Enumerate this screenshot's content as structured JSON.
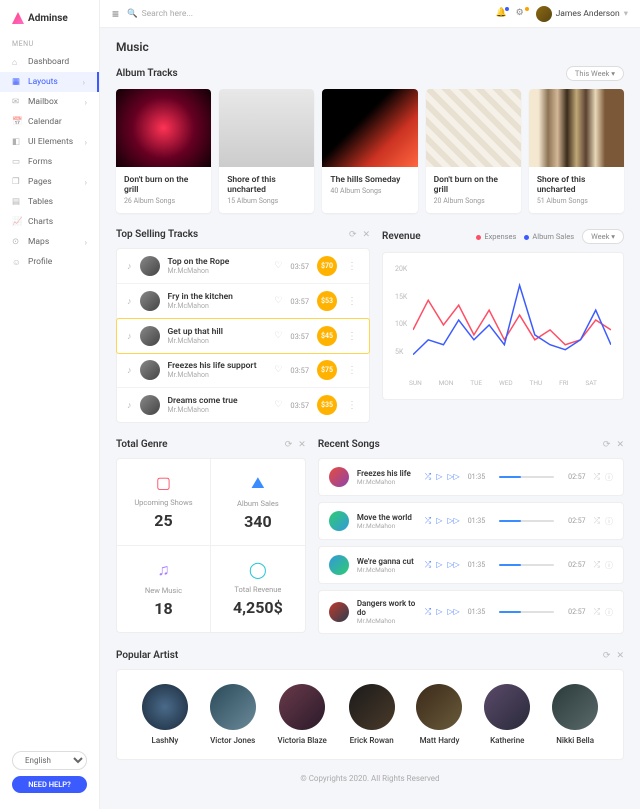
{
  "brand": "Adminse",
  "menuLabel": "MENU",
  "nav": [
    {
      "label": "Dashboard",
      "exp": false
    },
    {
      "label": "Layouts",
      "exp": true,
      "active": true
    },
    {
      "label": "Mailbox",
      "exp": true
    },
    {
      "label": "Calendar",
      "exp": false
    },
    {
      "label": "UI Elements",
      "exp": true
    },
    {
      "label": "Forms",
      "exp": false
    },
    {
      "label": "Pages",
      "exp": true
    },
    {
      "label": "Tables",
      "exp": false
    },
    {
      "label": "Charts",
      "exp": false
    },
    {
      "label": "Maps",
      "exp": true
    },
    {
      "label": "Profile",
      "exp": false
    }
  ],
  "lang": "English",
  "help": "NEED HELP?",
  "searchPlaceholder": "Search here...",
  "user": "James Anderson",
  "pageTitle": "Music",
  "albumSection": "Album Tracks",
  "thisWeek": "This Week",
  "albums": [
    {
      "title": "Don't burn on the grill",
      "sub": "26 Album Songs"
    },
    {
      "title": "Shore of this uncharted",
      "sub": "15 Album Songs"
    },
    {
      "title": "The hills Someday",
      "sub": "40 Album Songs"
    },
    {
      "title": "Don't burn on the grill",
      "sub": "20 Album Songs"
    },
    {
      "title": "Shore of this uncharted",
      "sub": "51 Album Songs"
    }
  ],
  "topSelling": "Top Selling Tracks",
  "tracks": [
    {
      "name": "Top on the Rope",
      "artist": "Mr.McMahon",
      "dur": "03:57",
      "price": "$70"
    },
    {
      "name": "Fry in the kitchen",
      "artist": "Mr.McMahon",
      "dur": "03:57",
      "price": "$53"
    },
    {
      "name": "Get up that hill",
      "artist": "Mr.McMahon",
      "dur": "03:57",
      "price": "$45"
    },
    {
      "name": "Freezes his life support",
      "artist": "Mr.McMahon",
      "dur": "03:57",
      "price": "$75"
    },
    {
      "name": "Dreams come true",
      "artist": "Mr.McMahon",
      "dur": "03:57",
      "price": "$35"
    }
  ],
  "revenue": "Revenue",
  "legend": {
    "expenses": "Expenses",
    "sales": "Album Sales",
    "period": "Week"
  },
  "chart_data": {
    "type": "line",
    "categories": [
      "SUN",
      "MON",
      "TUE",
      "WED",
      "THU",
      "FRI",
      "SAT"
    ],
    "series": [
      {
        "name": "Expenses",
        "color": "#ff4d64",
        "values": [
          8,
          14,
          9,
          13,
          7,
          12,
          6,
          11,
          6,
          8,
          5,
          6,
          10,
          8
        ]
      },
      {
        "name": "Album Sales",
        "color": "#3b5bff",
        "values": [
          3,
          6,
          5,
          10,
          6,
          9,
          5,
          17,
          7,
          5,
          4,
          6,
          12,
          5
        ]
      }
    ],
    "ylim": [
      0,
      20
    ],
    "yticks": [
      "20K",
      "15K",
      "10K",
      "5K"
    ]
  },
  "genreTitle": "Total Genre",
  "genre": [
    {
      "label": "Upcoming Shows",
      "value": "25",
      "color": "#ff4d64"
    },
    {
      "label": "Album Sales",
      "value": "340",
      "color": "#3b8cff"
    },
    {
      "label": "New Music",
      "value": "18",
      "color": "#a97bff"
    },
    {
      "label": "Total Revenue",
      "value": "4,250$",
      "color": "#26c6da"
    }
  ],
  "recentTitle": "Recent Songs",
  "songs": [
    {
      "name": "Freezes his life",
      "artist": "Mr.McMahon",
      "start": "01:35",
      "end": "02:57"
    },
    {
      "name": "Move the world",
      "artist": "Mr.McMahon",
      "start": "01:35",
      "end": "02:57"
    },
    {
      "name": "We're ganna cut",
      "artist": "Mr.McMahon",
      "start": "01:35",
      "end": "02:57"
    },
    {
      "name": "Dangers work to do",
      "artist": "Mr.McMahon",
      "start": "01:35",
      "end": "02:57"
    }
  ],
  "popArtist": "Popular Artist",
  "artists": [
    "LashNy",
    "Victor Jones",
    "Victoria Blaze",
    "Erick Rowan",
    "Matt Hardy",
    "Katherine",
    "Nikki Bella"
  ],
  "footer": "© Copyrights 2020. All Rights Reserved"
}
